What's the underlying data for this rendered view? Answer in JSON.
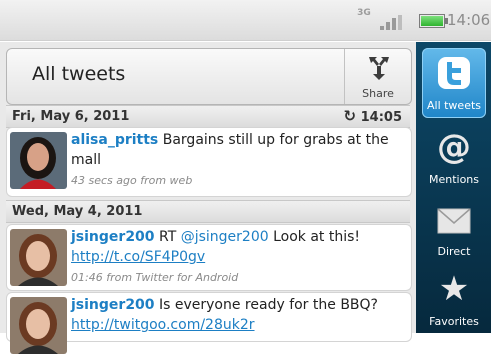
{
  "status_bar": {
    "network": "3G",
    "time": "14:06",
    "colors": {
      "battery": "#2fb42f"
    }
  },
  "header": {
    "title": "All tweets",
    "share_label": "Share"
  },
  "sections": [
    {
      "date": "Fri, May 6, 2011",
      "refresh_time": "14:05",
      "tweets": [
        {
          "user": "alisa_pritts",
          "text": "Bargains still up for grabs at the mall",
          "meta": "43 secs ago from web"
        }
      ]
    },
    {
      "date": "Wed, May 4, 2011",
      "tweets": [
        {
          "user": "jsinger200",
          "pre": "RT",
          "mention": "@jsinger200",
          "post": "Look at this!",
          "link": "http://t.co/SF4P0gv",
          "meta": "01:46 from Twitter for Android"
        },
        {
          "user": "jsinger200",
          "text": "Is everyone ready for the BBQ?",
          "link": "http://twitgoo.com/28uk2r"
        }
      ]
    }
  ],
  "side_tabs": [
    {
      "label": "All tweets",
      "icon": "twitter-bird-icon",
      "active": true
    },
    {
      "label": "Mentions",
      "icon": "at-sign-icon"
    },
    {
      "label": "Direct",
      "icon": "envelope-icon"
    },
    {
      "label": "Favorites",
      "icon": "star-icon"
    }
  ],
  "colors": {
    "accent": "#1d7fc4",
    "side_panel": "#0d4868",
    "active_tab": "#3aa0dc"
  }
}
